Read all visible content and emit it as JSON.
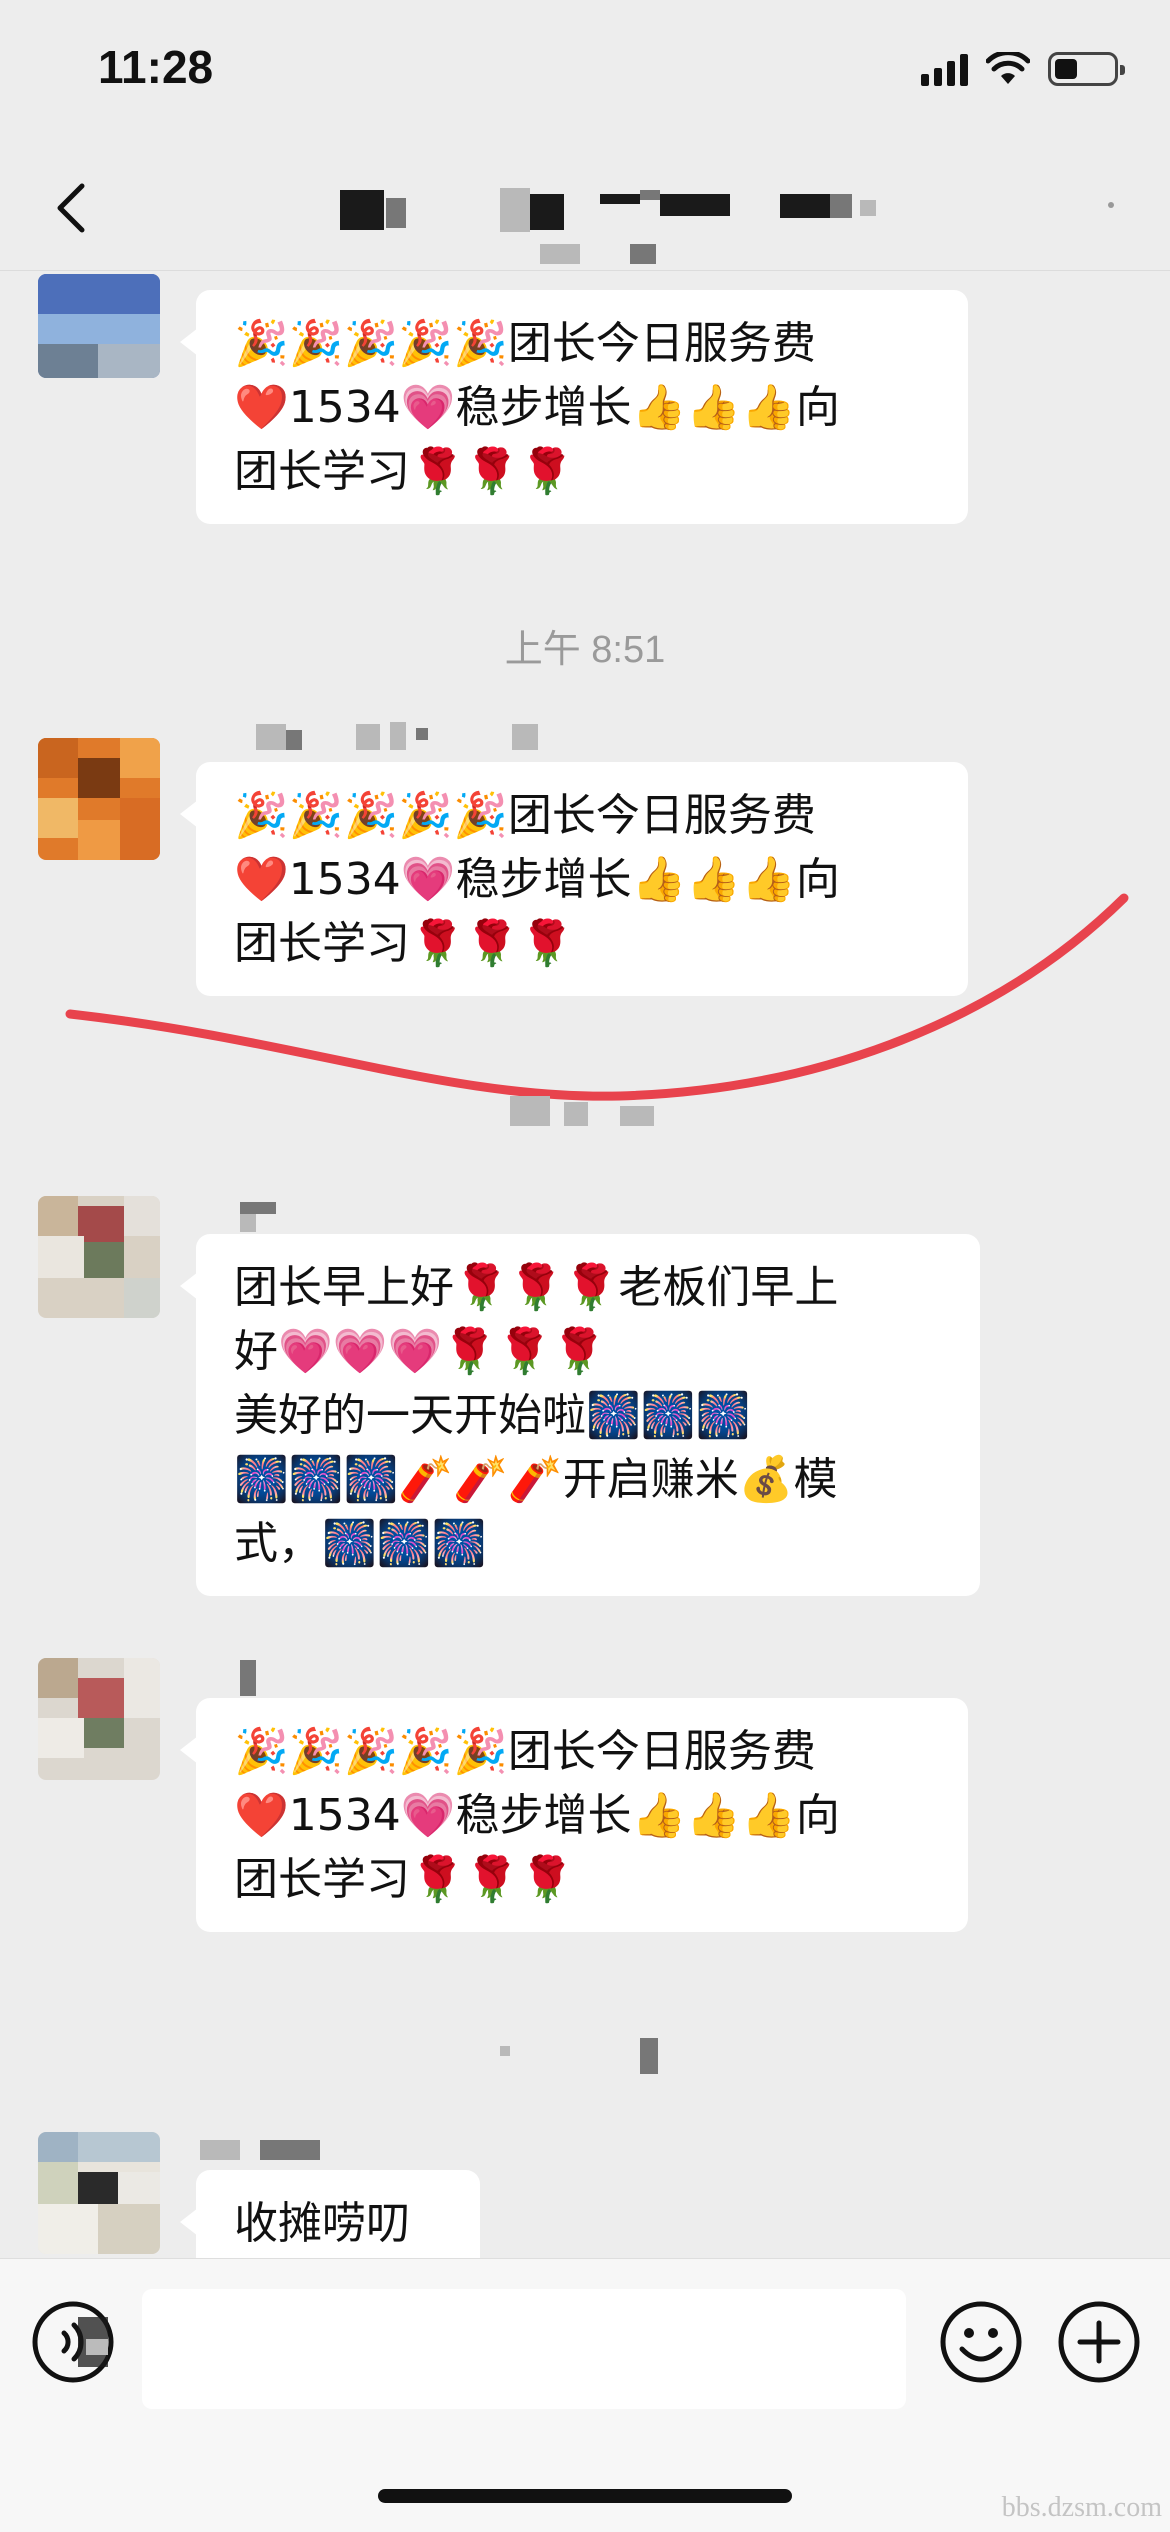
{
  "status_bar": {
    "time": "11:28"
  },
  "chat": {
    "messages": [
      {
        "text": "🎉🎉🎉🎉🎉团长今日服务费\n❤️1534💗稳步增长👍👍👍向\n团长学习🌹🌹🌹"
      },
      {
        "text": "🎉🎉🎉🎉🎉团长今日服务费\n❤️1534💗稳步增长👍👍👍向\n团长学习🌹🌹🌹"
      },
      {
        "text": "团长早上好🌹🌹🌹老板们早上\n好💗💗💗🌹🌹🌹\n美好的一天开始啦🎆🎆🎆\n🎆🎆🎆🧨🧨🧨开启赚米💰模\n式，🎆🎆🎆"
      },
      {
        "text": "🎉🎉🎉🎉🎉团长今日服务费\n❤️1534💗稳步增长👍👍👍向\n团长学习🌹🌹🌹"
      },
      {
        "text": "收摊唠叨"
      }
    ],
    "timestamps": [
      "上午 8:51"
    ]
  },
  "input_bar": {
    "placeholder": ""
  },
  "annotation": {
    "color": "#e8434d"
  },
  "watermark": "bbs.dzsm.com"
}
